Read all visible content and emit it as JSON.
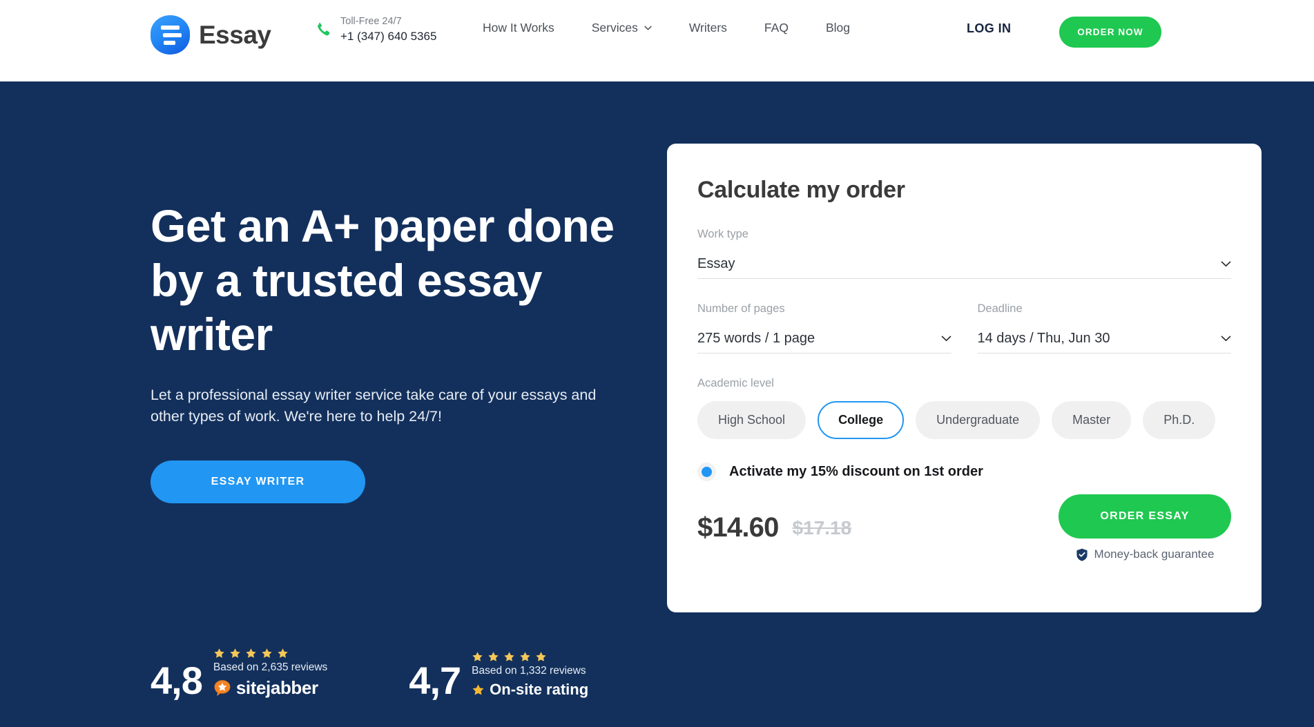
{
  "header": {
    "logo_text": "Essay",
    "logo_icon": "essay-lines-logo-icon",
    "phone_icon": "phone-icon",
    "phone_label": "Toll-Free 24/7",
    "phone_number": "+1 (347) 640 5365",
    "nav": [
      {
        "label": "How It Works",
        "has_chevron": false
      },
      {
        "label": "Services",
        "has_chevron": true
      },
      {
        "label": "Writers",
        "has_chevron": false
      },
      {
        "label": "FAQ",
        "has_chevron": false
      },
      {
        "label": "Blog",
        "has_chevron": false
      }
    ],
    "login_label": "LOG IN",
    "order_now_label": "ORDER NOW"
  },
  "hero": {
    "title": "Get an A+ paper done by a trusted essay writer",
    "subtitle": "Let a professional essay writer service take care of your essays and other types of work. We're here to help 24/7!",
    "cta_label": "ESSAY WRITER"
  },
  "ratings": [
    {
      "score": "4,8",
      "stars": 5,
      "reviews": "Based on 2,635 reviews",
      "brand": "sitejabber",
      "brand_icon": "sitejabber-star-bubble-icon"
    },
    {
      "score": "4,7",
      "stars": 5,
      "reviews": "Based on 1,332 reviews",
      "brand": "On-site rating",
      "brand_icon": "star-icon"
    }
  ],
  "calculator": {
    "title": "Calculate my order",
    "work_type": {
      "label": "Work type",
      "value": "Essay"
    },
    "pages": {
      "label": "Number of pages",
      "value": "275 words / 1 page"
    },
    "deadline": {
      "label": "Deadline",
      "value": "14 days / Thu, Jun 30"
    },
    "academic_level": {
      "label": "Academic level",
      "options": [
        "High School",
        "College",
        "Undergraduate",
        "Master",
        "Ph.D."
      ],
      "selected": "College"
    },
    "discount": {
      "label": "Activate my 15% discount on 1st order",
      "checked": true
    },
    "price_now": "$14.60",
    "price_old": "$17.18",
    "order_button_label": "ORDER ESSAY",
    "guarantee_text": "Money-back guarantee",
    "guarantee_icon": "shield-check-icon"
  },
  "colors": {
    "navy": "#13305c",
    "green": "#1fc850",
    "blue": "#2196f3",
    "star_gold": "#f5c758",
    "orange": "#f58220"
  }
}
